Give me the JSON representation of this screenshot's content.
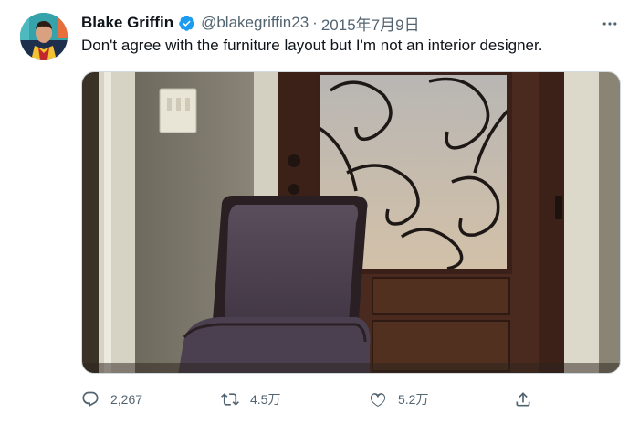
{
  "tweet": {
    "author_name": "Blake Griffin",
    "handle": "@blakegriffin23",
    "separator": "·",
    "date": "2015年7月9日",
    "text": "Don't agree with the furniture layout but I'm not an interior designer.",
    "verified": true
  },
  "actions": {
    "reply_count": "2,267",
    "retweet_count": "4.5万",
    "like_count": "5.2万"
  },
  "icons": {
    "reply": "reply-icon",
    "retweet": "retweet-icon",
    "like": "heart-icon",
    "share": "share-icon",
    "more": "more-icon",
    "verified": "verified-badge-icon"
  },
  "colors": {
    "text_primary": "#0f1419",
    "text_secondary": "#536471",
    "verified_blue": "#1d9bf0"
  }
}
